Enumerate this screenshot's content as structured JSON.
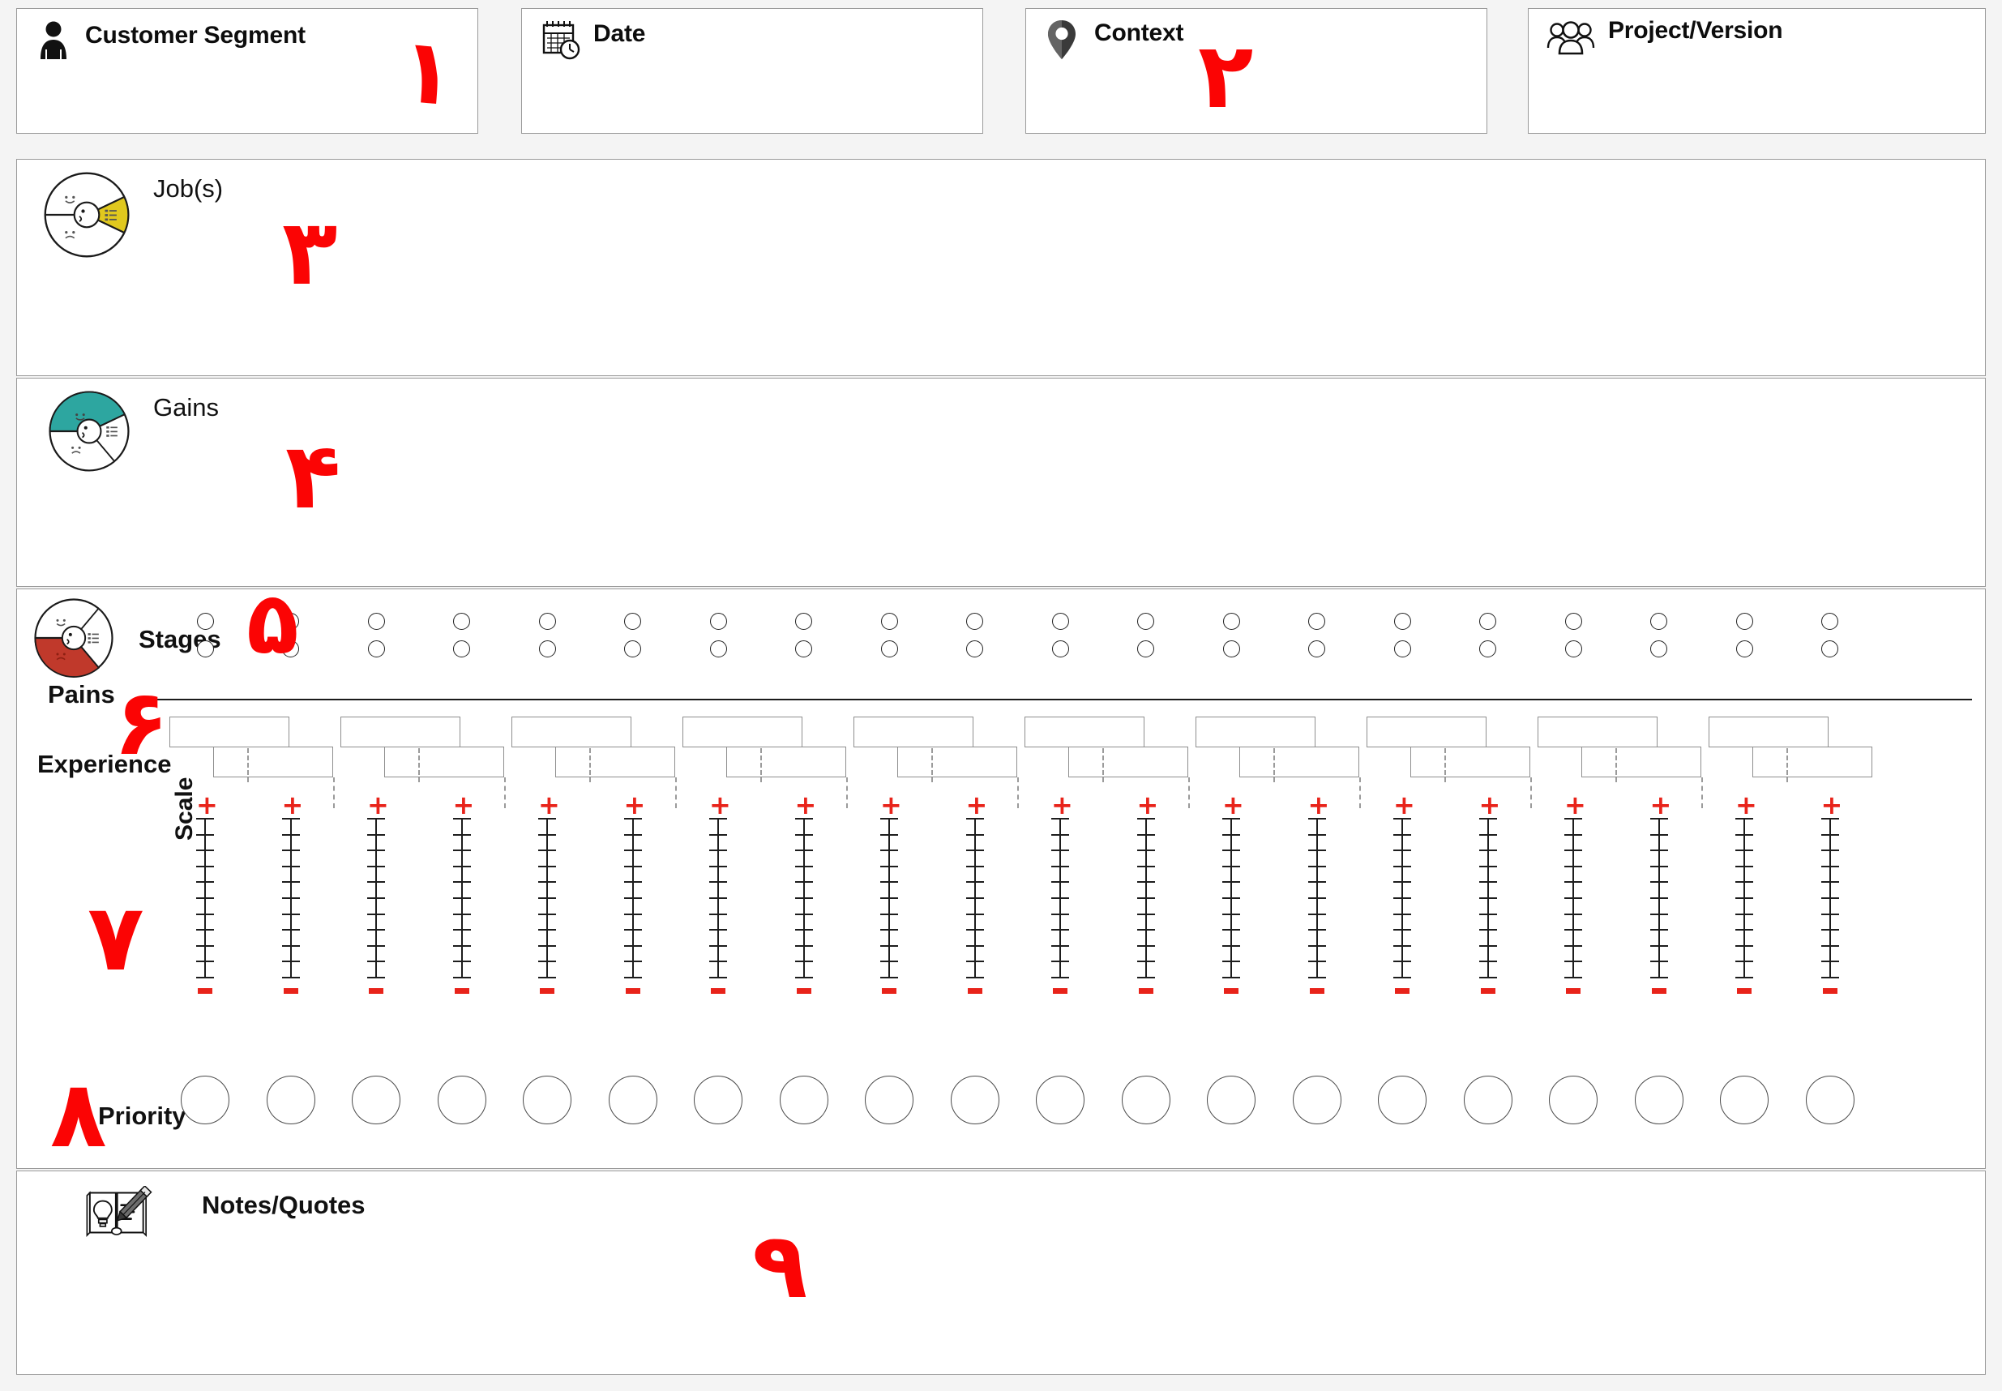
{
  "header": {
    "fields": [
      {
        "label": "Customer Segment",
        "icon": "person-icon",
        "value": ""
      },
      {
        "label": "Date",
        "icon": "calendar-clock-icon",
        "value": ""
      },
      {
        "label": "Context",
        "icon": "map-pin-icon",
        "value": ""
      },
      {
        "label": "Project/Version",
        "icon": "people-group-icon",
        "value": ""
      }
    ]
  },
  "sections": {
    "jobs": {
      "label": "Job(s)",
      "icon": "persona-wheel-yellow-icon",
      "accent": "#e0c81e",
      "value": ""
    },
    "gains": {
      "label": "Gains",
      "icon": "persona-wheel-teal-icon",
      "accent": "#2da6a0",
      "value": ""
    },
    "pains": {
      "wheel_icon": "persona-wheel-red-icon",
      "accent": "#c0392b",
      "stages_label": "Stages",
      "pains_label": "Pains",
      "experience_label": "Experience"
    },
    "scale": {
      "label": "Scale",
      "plus": "+",
      "minus": "-",
      "tick_count": 11,
      "column_count": 20
    },
    "priority": {
      "label": "Priority",
      "circle_count": 20
    },
    "notes": {
      "label": "Notes/Quotes",
      "icon": "book-lightbulb-pencil-icon",
      "value": ""
    }
  },
  "stage_dots": {
    "rows": 2,
    "per_row": 20
  },
  "stage_boxes": {
    "top_row_count": 10,
    "bottom_row_count": 10
  },
  "annotations": {
    "accent_color": "#fb0404",
    "items": [
      {
        "numeral": "۱",
        "refers_to": "customer-segment"
      },
      {
        "numeral": "۲",
        "refers_to": "context"
      },
      {
        "numeral": "۳",
        "refers_to": "jobs"
      },
      {
        "numeral": "۴",
        "refers_to": "gains"
      },
      {
        "numeral": "۵",
        "refers_to": "stages"
      },
      {
        "numeral": "۶",
        "refers_to": "pains-experience"
      },
      {
        "numeral": "۷",
        "refers_to": "scale"
      },
      {
        "numeral": "۸",
        "refers_to": "priority"
      },
      {
        "numeral": "۹",
        "refers_to": "notes-quotes"
      }
    ]
  }
}
